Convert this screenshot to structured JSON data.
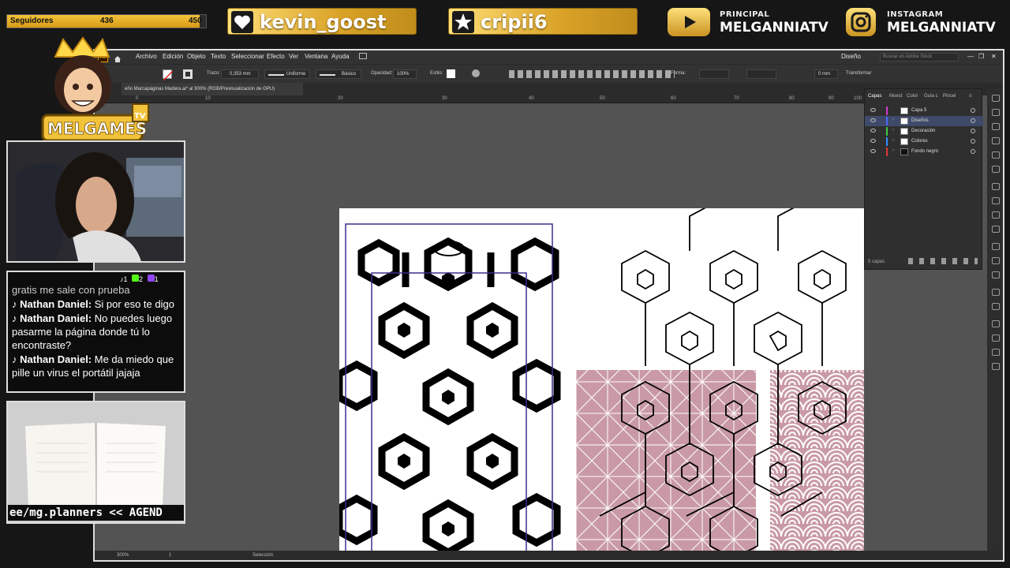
{
  "overlay": {
    "followers": {
      "label": "Seguidores",
      "current": "436",
      "goal": "450",
      "progress": 0.969
    },
    "recent_follow": "kevin_goost",
    "recent_star": "cripii6",
    "youtube": {
      "label": "PRINCIPAL",
      "name": "MELGANNIATV"
    },
    "instagram": {
      "label": "INSTAGRAM",
      "name": "MELGANNIATV"
    },
    "logo": {
      "text": "MELGAMES",
      "suffix": "TV"
    }
  },
  "illustrator": {
    "app_badge": "Ai",
    "menu": [
      "Archivo",
      "Edición",
      "Objeto",
      "Texto",
      "Seleccionar",
      "Efecto",
      "Ver",
      "Ventana",
      "Ayuda"
    ],
    "workspace": "Diseño",
    "search_placeholder": "Buscar en Adobe Stock",
    "control": {
      "trazo_label": "Trazo:",
      "stroke_weight": "0,353 mm",
      "profile": "Uniforme",
      "brush": "Básico",
      "opacity_label": "Opacidad:",
      "opacity": "100%",
      "style_label": "Estilo:",
      "forma_label": "Forma:",
      "corner": "0 mm",
      "transform_label": "Transformar"
    },
    "doc_tab": "eño Marcapáginas Madera.ai* al 300% (RGB/Previsualización de GPU)",
    "ruler_ticks": [
      "0",
      "10",
      "20",
      "30",
      "40",
      "50",
      "60",
      "70",
      "80",
      "90",
      "100"
    ],
    "status": {
      "zoom": "300%",
      "artboard": "1",
      "tool": "Selección"
    },
    "layers_panel": {
      "tabs": [
        "Capas",
        "Muest",
        "Color",
        "Guía c",
        "Pincel"
      ],
      "layers": [
        {
          "name": "Capa 5",
          "color": "#d03cd0"
        },
        {
          "name": "Diseños",
          "color": "#4a6cff"
        },
        {
          "name": "Decoración",
          "color": "#3ccc3c"
        },
        {
          "name": "Colores",
          "color": "#3c8cff"
        },
        {
          "name": "Fondo negro",
          "color": "#e03c3c"
        }
      ],
      "count": "5 capas"
    }
  },
  "chat": {
    "counters": {
      "tiktok": "1",
      "kick": "2",
      "twitch": "1"
    },
    "first_line": "gratis me sale con prueba",
    "messages": [
      {
        "user": "Nathan Daniel:",
        "text": "Si por eso te digo"
      },
      {
        "user": "Nathan Daniel:",
        "text": "No puedes luego pasarme la página donde tú lo encontraste?"
      },
      {
        "user": "Nathan Daniel:",
        "text": "Me da miedo que pille un virus el portátil jajaja"
      }
    ]
  },
  "ad": {
    "text": "ee/mg.planners << AGEND"
  }
}
